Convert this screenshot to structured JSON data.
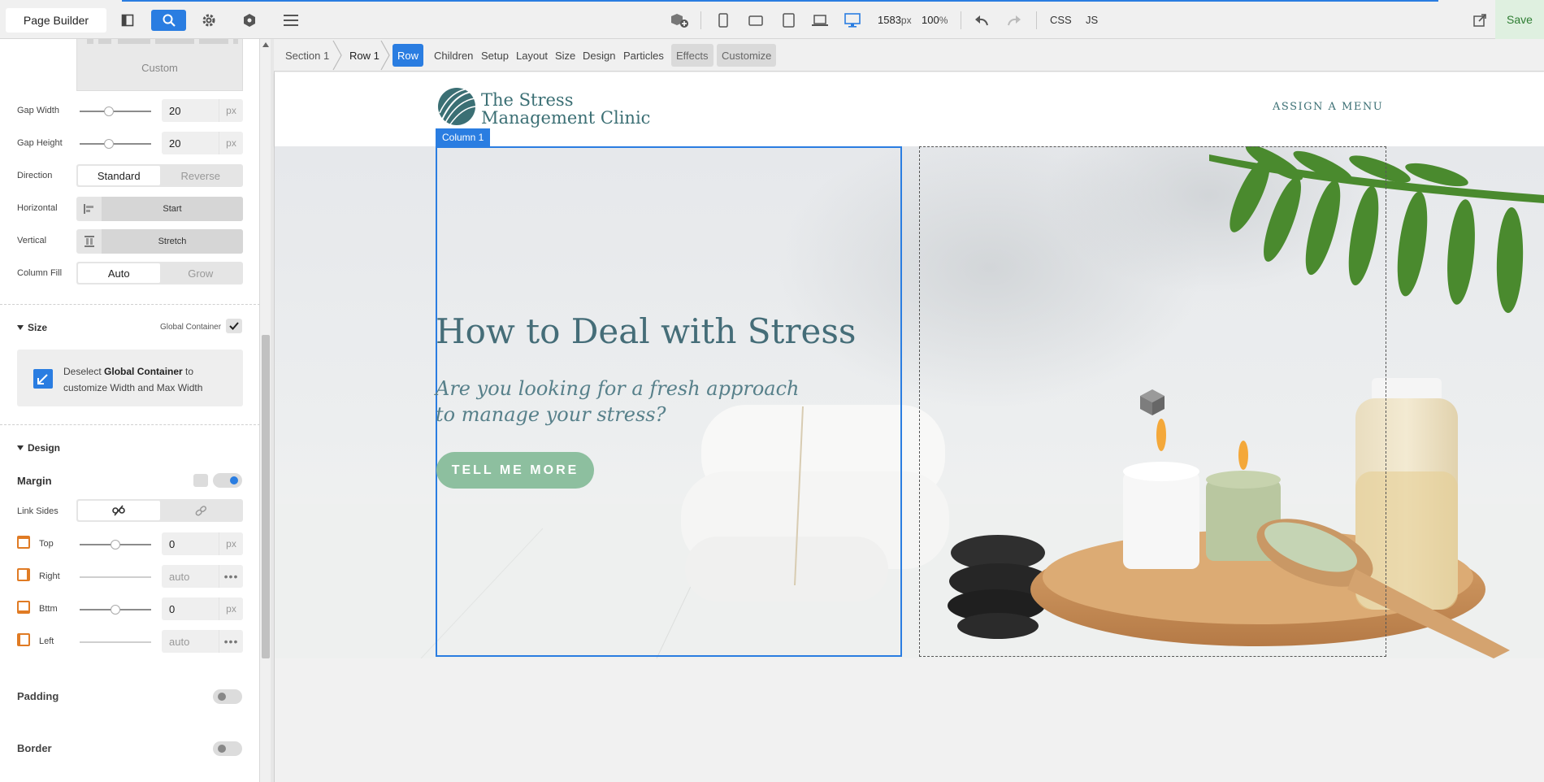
{
  "toolbar": {
    "app_title": "Page Builder",
    "viewport_width": "1583",
    "viewport_unit": "px",
    "zoom": "100",
    "zoom_unit": "%",
    "css_label": "CSS",
    "js_label": "JS",
    "save_label": "Save"
  },
  "left_panel": {
    "custom_label": "Custom",
    "gap_width": {
      "label": "Gap Width",
      "value": "20",
      "unit": "px"
    },
    "gap_height": {
      "label": "Gap Height",
      "value": "20",
      "unit": "px"
    },
    "direction": {
      "label": "Direction",
      "options": [
        "Standard",
        "Reverse"
      ],
      "selected": "Standard"
    },
    "horizontal": {
      "label": "Horizontal",
      "value": "Start"
    },
    "vertical": {
      "label": "Vertical",
      "value": "Stretch"
    },
    "column_fill": {
      "label": "Column Fill",
      "options": [
        "Auto",
        "Grow"
      ],
      "selected": "Auto"
    },
    "size": {
      "title": "Size",
      "global_container_label": "Global Container",
      "info_prefix": "Deselect ",
      "info_bold": "Global Container",
      "info_suffix": " to customize Width and Max Width"
    },
    "design": {
      "title": "Design",
      "margin_title": "Margin",
      "link_sides_label": "Link Sides",
      "top": {
        "label": "Top",
        "value": "0",
        "unit": "px"
      },
      "right": {
        "label": "Right",
        "value": "auto",
        "more": "•••"
      },
      "bottom": {
        "label": "Bttm",
        "value": "0",
        "unit": "px"
      },
      "left": {
        "label": "Left",
        "value": "auto",
        "more": "•••"
      },
      "padding_label": "Padding",
      "border_label": "Border"
    }
  },
  "breadcrumb": {
    "section": "Section 1",
    "row": "Row 1"
  },
  "context_tabs": {
    "active": "Row",
    "items": [
      "Children",
      "Setup",
      "Layout",
      "Size",
      "Design",
      "Particles"
    ],
    "effects": "Effects",
    "customize": "Customize"
  },
  "site": {
    "logo_line1": "The Stress",
    "logo_line2": "Management Clinic",
    "menu_placeholder": "ASSIGN A MENU",
    "column_label": "Column 1",
    "hero_title": "How to Deal with Stress",
    "hero_subtitle_line1": "Are you looking for a fresh approach",
    "hero_subtitle_line2": "to manage your stress?",
    "cta_label": "TELL ME MORE"
  },
  "colors": {
    "accent": "#2a7de1",
    "brand_teal": "#3b6f74",
    "cta_green": "#8dbf9f",
    "save_bg": "#dff0e0"
  }
}
